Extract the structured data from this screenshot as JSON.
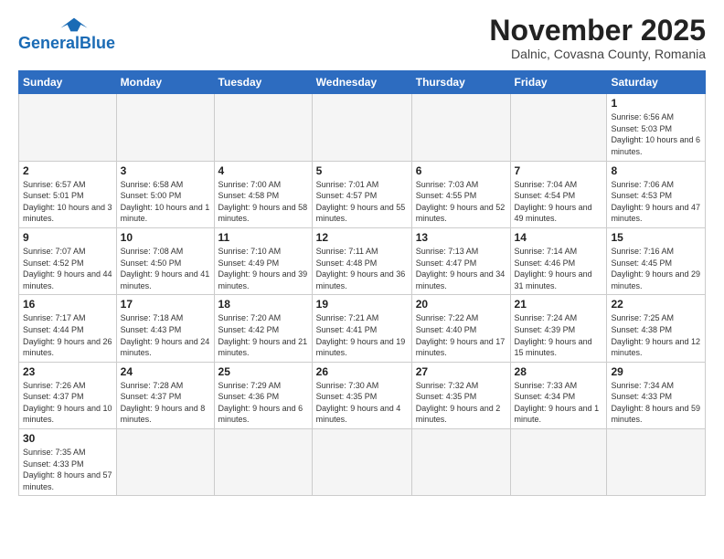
{
  "header": {
    "logo_general": "General",
    "logo_blue": "Blue",
    "month_title": "November 2025",
    "location": "Dalnic, Covasna County, Romania"
  },
  "weekdays": [
    "Sunday",
    "Monday",
    "Tuesday",
    "Wednesday",
    "Thursday",
    "Friday",
    "Saturday"
  ],
  "weeks": [
    [
      {
        "num": "",
        "info": ""
      },
      {
        "num": "",
        "info": ""
      },
      {
        "num": "",
        "info": ""
      },
      {
        "num": "",
        "info": ""
      },
      {
        "num": "",
        "info": ""
      },
      {
        "num": "",
        "info": ""
      },
      {
        "num": "1",
        "info": "Sunrise: 6:56 AM\nSunset: 5:03 PM\nDaylight: 10 hours\nand 6 minutes."
      }
    ],
    [
      {
        "num": "2",
        "info": "Sunrise: 6:57 AM\nSunset: 5:01 PM\nDaylight: 10 hours\nand 3 minutes."
      },
      {
        "num": "3",
        "info": "Sunrise: 6:58 AM\nSunset: 5:00 PM\nDaylight: 10 hours\nand 1 minute."
      },
      {
        "num": "4",
        "info": "Sunrise: 7:00 AM\nSunset: 4:58 PM\nDaylight: 9 hours\nand 58 minutes."
      },
      {
        "num": "5",
        "info": "Sunrise: 7:01 AM\nSunset: 4:57 PM\nDaylight: 9 hours\nand 55 minutes."
      },
      {
        "num": "6",
        "info": "Sunrise: 7:03 AM\nSunset: 4:55 PM\nDaylight: 9 hours\nand 52 minutes."
      },
      {
        "num": "7",
        "info": "Sunrise: 7:04 AM\nSunset: 4:54 PM\nDaylight: 9 hours\nand 49 minutes."
      },
      {
        "num": "8",
        "info": "Sunrise: 7:06 AM\nSunset: 4:53 PM\nDaylight: 9 hours\nand 47 minutes."
      }
    ],
    [
      {
        "num": "9",
        "info": "Sunrise: 7:07 AM\nSunset: 4:52 PM\nDaylight: 9 hours\nand 44 minutes."
      },
      {
        "num": "10",
        "info": "Sunrise: 7:08 AM\nSunset: 4:50 PM\nDaylight: 9 hours\nand 41 minutes."
      },
      {
        "num": "11",
        "info": "Sunrise: 7:10 AM\nSunset: 4:49 PM\nDaylight: 9 hours\nand 39 minutes."
      },
      {
        "num": "12",
        "info": "Sunrise: 7:11 AM\nSunset: 4:48 PM\nDaylight: 9 hours\nand 36 minutes."
      },
      {
        "num": "13",
        "info": "Sunrise: 7:13 AM\nSunset: 4:47 PM\nDaylight: 9 hours\nand 34 minutes."
      },
      {
        "num": "14",
        "info": "Sunrise: 7:14 AM\nSunset: 4:46 PM\nDaylight: 9 hours\nand 31 minutes."
      },
      {
        "num": "15",
        "info": "Sunrise: 7:16 AM\nSunset: 4:45 PM\nDaylight: 9 hours\nand 29 minutes."
      }
    ],
    [
      {
        "num": "16",
        "info": "Sunrise: 7:17 AM\nSunset: 4:44 PM\nDaylight: 9 hours\nand 26 minutes."
      },
      {
        "num": "17",
        "info": "Sunrise: 7:18 AM\nSunset: 4:43 PM\nDaylight: 9 hours\nand 24 minutes."
      },
      {
        "num": "18",
        "info": "Sunrise: 7:20 AM\nSunset: 4:42 PM\nDaylight: 9 hours\nand 21 minutes."
      },
      {
        "num": "19",
        "info": "Sunrise: 7:21 AM\nSunset: 4:41 PM\nDaylight: 9 hours\nand 19 minutes."
      },
      {
        "num": "20",
        "info": "Sunrise: 7:22 AM\nSunset: 4:40 PM\nDaylight: 9 hours\nand 17 minutes."
      },
      {
        "num": "21",
        "info": "Sunrise: 7:24 AM\nSunset: 4:39 PM\nDaylight: 9 hours\nand 15 minutes."
      },
      {
        "num": "22",
        "info": "Sunrise: 7:25 AM\nSunset: 4:38 PM\nDaylight: 9 hours\nand 12 minutes."
      }
    ],
    [
      {
        "num": "23",
        "info": "Sunrise: 7:26 AM\nSunset: 4:37 PM\nDaylight: 9 hours\nand 10 minutes."
      },
      {
        "num": "24",
        "info": "Sunrise: 7:28 AM\nSunset: 4:37 PM\nDaylight: 9 hours\nand 8 minutes."
      },
      {
        "num": "25",
        "info": "Sunrise: 7:29 AM\nSunset: 4:36 PM\nDaylight: 9 hours\nand 6 minutes."
      },
      {
        "num": "26",
        "info": "Sunrise: 7:30 AM\nSunset: 4:35 PM\nDaylight: 9 hours\nand 4 minutes."
      },
      {
        "num": "27",
        "info": "Sunrise: 7:32 AM\nSunset: 4:35 PM\nDaylight: 9 hours\nand 2 minutes."
      },
      {
        "num": "28",
        "info": "Sunrise: 7:33 AM\nSunset: 4:34 PM\nDaylight: 9 hours\nand 1 minute."
      },
      {
        "num": "29",
        "info": "Sunrise: 7:34 AM\nSunset: 4:33 PM\nDaylight: 8 hours\nand 59 minutes."
      }
    ],
    [
      {
        "num": "30",
        "info": "Sunrise: 7:35 AM\nSunset: 4:33 PM\nDaylight: 8 hours\nand 57 minutes."
      },
      {
        "num": "",
        "info": ""
      },
      {
        "num": "",
        "info": ""
      },
      {
        "num": "",
        "info": ""
      },
      {
        "num": "",
        "info": ""
      },
      {
        "num": "",
        "info": ""
      },
      {
        "num": "",
        "info": ""
      }
    ]
  ]
}
